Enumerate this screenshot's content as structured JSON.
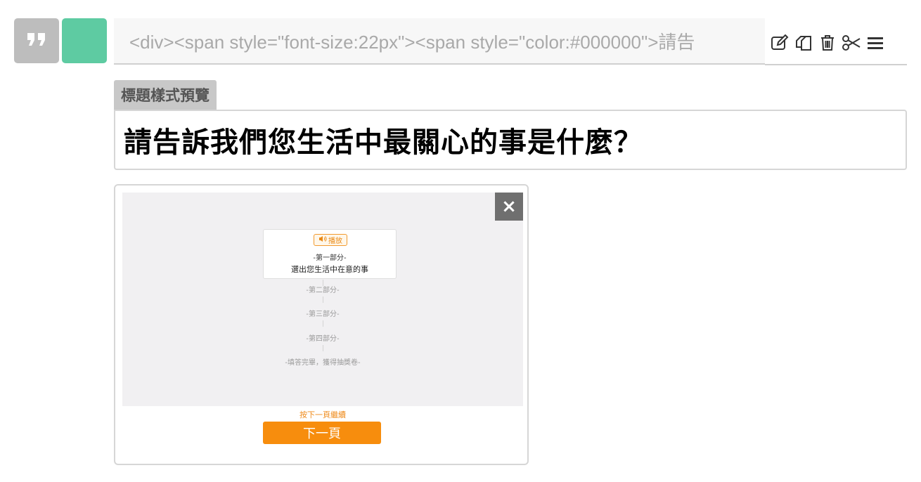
{
  "toolbar": {
    "source_value": "<div><span style=\"font-size:22px\"><span style=\"color:#000000\">請告",
    "icons": [
      "quote-icon",
      "edit-icon",
      "copy-icon",
      "trash-icon",
      "scissors-icon",
      "menu-icon"
    ]
  },
  "preview": {
    "label": "標題樣式預覽",
    "title": "請告訴我們您生活中最關心的事是什麼？"
  },
  "image_preview": {
    "close": "×",
    "play_label": "播放",
    "part1": "-第一部分-",
    "part1_desc": "選出您生活中在意的事",
    "part2": "-第二部分-",
    "part3": "-第三部分-",
    "part4": "-第四部分-",
    "finish": "-填答完畢，獲得抽獎卷-",
    "hint": "按下一頁繼續",
    "next": "下一頁"
  },
  "colors": {
    "accent_green": "#5ecba2",
    "accent_orange": "#f78d0d",
    "quote_gray": "#bdbdbd"
  }
}
